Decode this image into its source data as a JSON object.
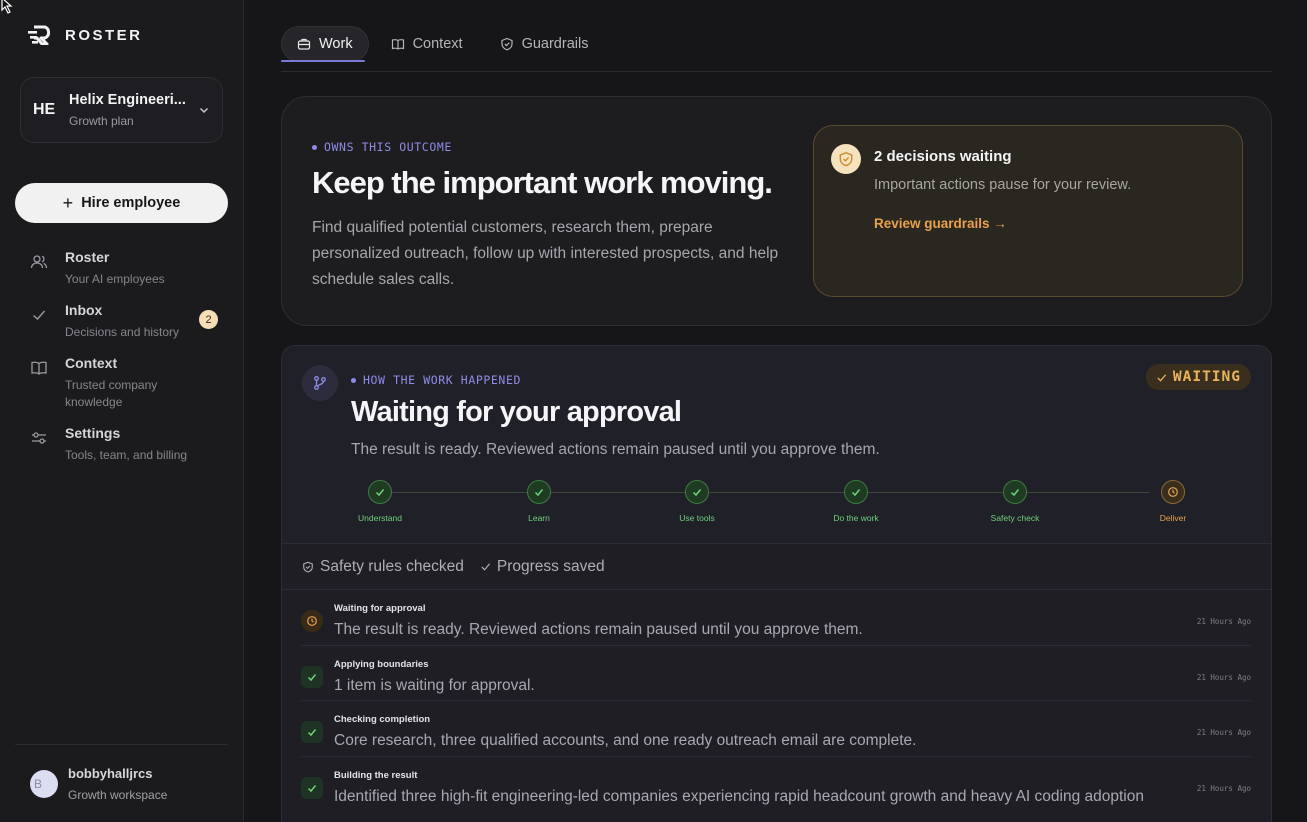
{
  "brand": {
    "name": "ROSTER"
  },
  "workspace": {
    "initials": "HE",
    "name": "Helix Engineeri...",
    "plan": "Growth plan"
  },
  "hire_button": {
    "label": "Hire employee"
  },
  "nav": [
    {
      "title": "Roster",
      "sub": "Your AI employees",
      "icon": "users-icon"
    },
    {
      "title": "Inbox",
      "sub": "Decisions and history",
      "icon": "check-icon",
      "badge": "2"
    },
    {
      "title": "Context",
      "sub": "Trusted company knowledge",
      "icon": "book-icon"
    },
    {
      "title": "Settings",
      "sub": "Tools, team, and billing",
      "icon": "sliders-icon"
    }
  ],
  "user": {
    "initial": "B",
    "name": "bobbyhalljrcs",
    "sub": "Growth workspace"
  },
  "tabs": [
    {
      "label": "Work",
      "icon": "briefcase-icon",
      "active": true
    },
    {
      "label": "Context",
      "icon": "book-icon",
      "active": false
    },
    {
      "label": "Guardrails",
      "icon": "shield-icon",
      "active": false
    }
  ],
  "hero": {
    "eyebrow": "OWNS THIS OUTCOME",
    "title": "Keep the important work moving.",
    "description": "Find qualified potential customers, research them, prepare personalized outreach, follow up with interested prospects, and help schedule sales calls."
  },
  "decision_card": {
    "title": "2 decisions waiting",
    "subtitle": "Important actions pause for your review.",
    "link": "Review guardrails →"
  },
  "work": {
    "eyebrow": "HOW THE WORK HAPPENED",
    "title": "Waiting for your approval",
    "subtitle": "The result is ready. Reviewed actions remain paused until you approve them.",
    "badge": "WAITING",
    "steps": [
      {
        "label": "Understand",
        "status": "done"
      },
      {
        "label": "Learn",
        "status": "done"
      },
      {
        "label": "Use tools",
        "status": "done"
      },
      {
        "label": "Do the work",
        "status": "done"
      },
      {
        "label": "Safety check",
        "status": "done"
      },
      {
        "label": "Deliver",
        "status": "pending"
      }
    ],
    "status_items": [
      "Safety rules checked",
      "Progress saved"
    ],
    "log": [
      {
        "title": "Waiting for approval",
        "text": "The result is ready. Reviewed actions remain paused until you approve them.",
        "time": "21 Hours Ago",
        "status": "pending"
      },
      {
        "title": "Applying boundaries",
        "text": "1 item is waiting for approval.",
        "time": "21 Hours Ago",
        "status": "done"
      },
      {
        "title": "Checking completion",
        "text": "Core research, three qualified accounts, and one ready outreach email are complete.",
        "time": "21 Hours Ago",
        "status": "done"
      },
      {
        "title": "Building the result",
        "text": "Identified three high-fit engineering-led companies experiencing rapid headcount growth and heavy AI coding adoption",
        "time": "21 Hours Ago",
        "status": "done"
      }
    ]
  },
  "colors": {
    "accent": "#8e8ce6",
    "success": "#6fd27a",
    "warning": "#e9a24a"
  }
}
